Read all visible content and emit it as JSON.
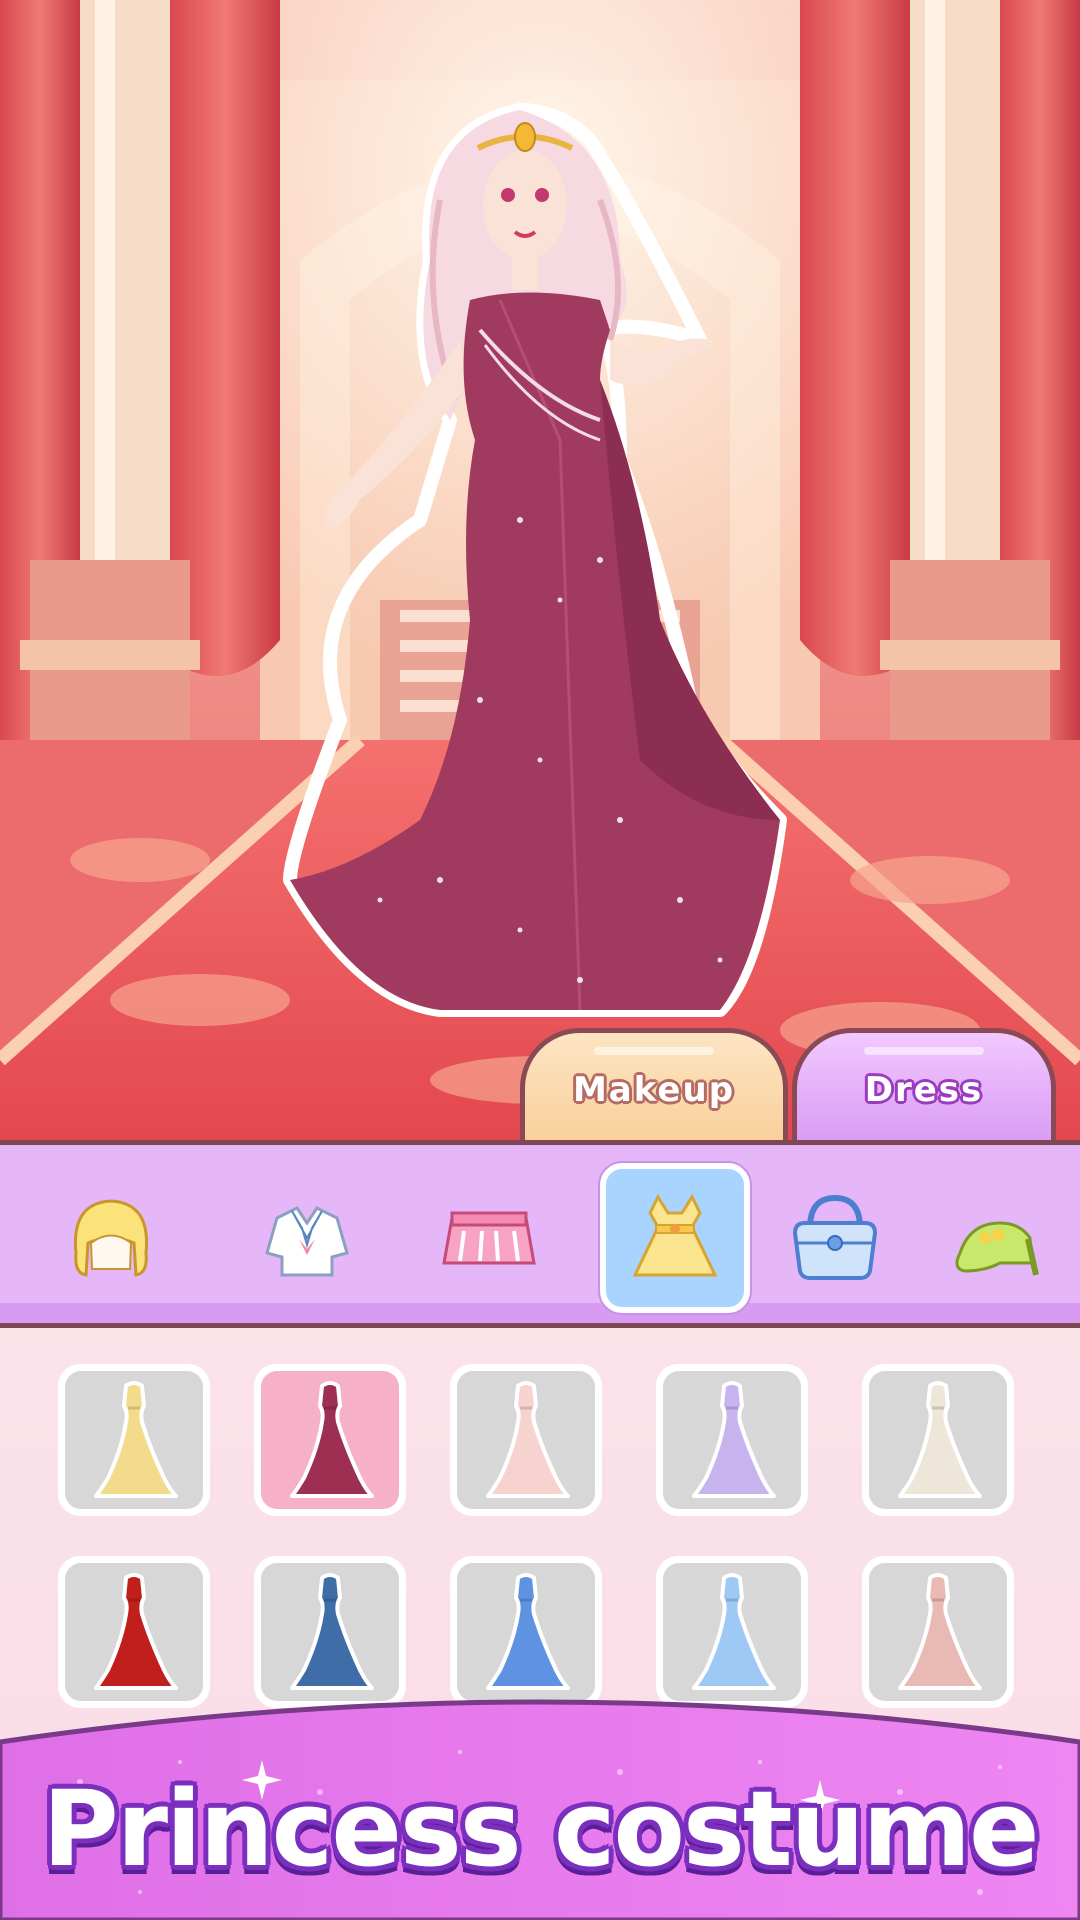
{
  "tabs": [
    {
      "label": "Makeup",
      "selected": false
    },
    {
      "label": "Dress",
      "selected": true
    }
  ],
  "categories": [
    {
      "icon": "hair-icon",
      "selected": false
    },
    {
      "icon": "top-icon",
      "selected": false
    },
    {
      "icon": "skirt-icon",
      "selected": false
    },
    {
      "icon": "dress-icon",
      "selected": true
    },
    {
      "icon": "bag-icon",
      "selected": false
    },
    {
      "icon": "shoes-icon",
      "selected": false
    }
  ],
  "items": [
    {
      "icon": "gown-gold-icon",
      "color": "#f2dc8c",
      "selected": false
    },
    {
      "icon": "gown-burgundy-icon",
      "color": "#9c2f52",
      "selected": true
    },
    {
      "icon": "gown-blush-icon",
      "color": "#f6d3cf",
      "selected": false
    },
    {
      "icon": "gown-lavender-icon",
      "color": "#c7b3ee",
      "selected": false
    },
    {
      "icon": "gown-ivory-icon",
      "color": "#eee6d8",
      "selected": false
    },
    {
      "icon": "gown-red-icon",
      "color": "#c0201c",
      "selected": false
    },
    {
      "icon": "gown-navy-icon",
      "color": "#3f6da8",
      "selected": false
    },
    {
      "icon": "gown-blue-icon",
      "color": "#5f93e2",
      "selected": false
    },
    {
      "icon": "gown-skyblue-icon",
      "color": "#9ec9f5",
      "selected": false
    },
    {
      "icon": "gown-rose-icon",
      "color": "#e9b9b4",
      "selected": false
    }
  ],
  "banner": {
    "title": "Princess costume"
  },
  "colors": {
    "scene": "#ef8b86",
    "category_bar": "#e6b7f8",
    "grid_background": "#fbe3ea",
    "banner": "#e27ef0",
    "title_outline": "#7b2fbf"
  }
}
